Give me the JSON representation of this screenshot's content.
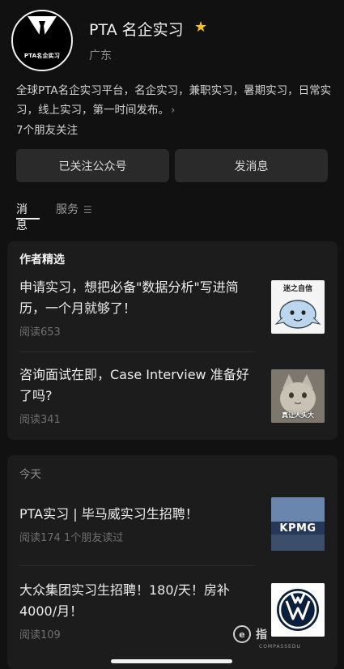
{
  "profile": {
    "name": "PTA 名企实习",
    "avatar_text": "PTA名企实习",
    "region": "广东",
    "description": "全球PTA名企实习平台，名企实习，兼职实习，暑期实习，日常实习，线上实习，第一时间发布。",
    "friends_following": "7个朋友关注",
    "star_color": "#f5c518"
  },
  "actions": {
    "follow_label": "已关注公众号",
    "message_label": "发消息"
  },
  "tabs": {
    "news": "消息",
    "service": "服务"
  },
  "featured": {
    "title": "作者精选",
    "articles": [
      {
        "title": "申请实习，想把必备\"数据分析\"写进简历，一个月就够了！",
        "meta": "阅读653",
        "thumb_text": "迷之自信"
      },
      {
        "title": "咨询面试在即，Case Interview 准备好了吗?",
        "meta": "阅读341",
        "thumb_text": "真让人头大"
      }
    ]
  },
  "today": {
    "title": "今天",
    "articles": [
      {
        "title": "PTA实习 | 毕马威实习生招聘！",
        "meta": "阅读174  1个朋友读过",
        "thumb_text": "KPMG"
      },
      {
        "title": "大众集团实习生招聘！180/天！房补4000/月！",
        "meta": "阅读109",
        "thumb_text": ""
      }
    ]
  },
  "watermark": {
    "text": "指",
    "sub": "COMPASSEDU"
  }
}
